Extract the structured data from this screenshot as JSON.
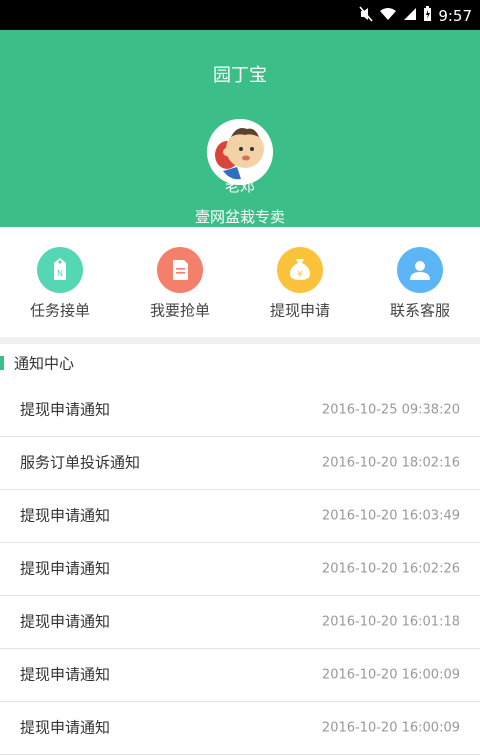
{
  "statusbar": {
    "time": "9:57"
  },
  "header": {
    "app_title": "园丁宝",
    "user_name": "老邓",
    "shop_name": "壹网盆栽专卖"
  },
  "actions": [
    {
      "label": "任务接单",
      "icon": "tag-icon",
      "color": "#55d6b4"
    },
    {
      "label": "我要抢单",
      "icon": "document-icon",
      "color": "#f47f6b"
    },
    {
      "label": "提现申请",
      "icon": "money-bag-icon",
      "color": "#fbc33b"
    },
    {
      "label": "联系客服",
      "icon": "user-icon",
      "color": "#5cb6f5"
    }
  ],
  "notice": {
    "section_title": "通知中心",
    "items": [
      {
        "title": "提现申请通知",
        "time": "2016-10-25 09:38:20"
      },
      {
        "title": "服务订单投诉通知",
        "time": "2016-10-20 18:02:16"
      },
      {
        "title": "提现申请通知",
        "time": "2016-10-20 16:03:49"
      },
      {
        "title": "提现申请通知",
        "time": "2016-10-20 16:02:26"
      },
      {
        "title": "提现申请通知",
        "time": "2016-10-20 16:01:18"
      },
      {
        "title": "提现申请通知",
        "time": "2016-10-20 16:00:09"
      },
      {
        "title": "提现申请通知",
        "time": "2016-10-20 16:00:09"
      }
    ]
  },
  "colors": {
    "brand_green": "#3cbe89"
  }
}
